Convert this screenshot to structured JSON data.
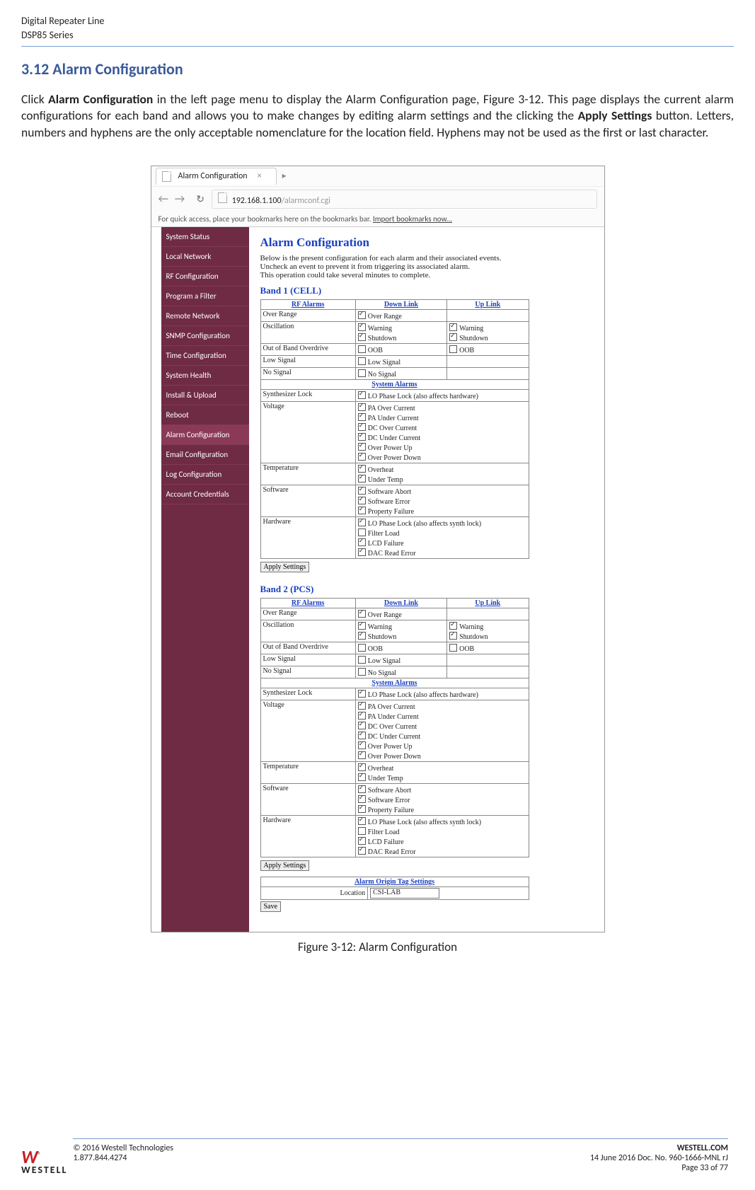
{
  "doc_header": {
    "line1": "Digital Repeater Line",
    "line2": "DSP85 Series"
  },
  "section": {
    "number_title": "3.12  Alarm Configuration"
  },
  "body": {
    "p1_pre": "Click ",
    "p1_b1": "Alarm Configuration",
    "p1_mid": " in the left page menu to display the Alarm Configuration page, Figure 3-12.  This page displays the current alarm configurations for each band and allows you to make changes by editing alarm settings and the clicking the ",
    "p1_b2": "Apply Settings",
    "p1_post": " button. Letters, numbers and hyphens are the only acceptable nomenclature for the location field.  Hyphens may not be used as the first or last character."
  },
  "figure_caption": "Figure 3-12: Alarm Configuration",
  "browser": {
    "tab_title": "Alarm Configuration",
    "tab_x": "×",
    "newtab": "",
    "addr_dark": "192.168.1.100",
    "addr_light": "/alarmconf.cgi",
    "bm_text": "For quick access, place your bookmarks here on the bookmarks bar.  ",
    "bm_link": "Import bookmarks now..."
  },
  "sidebar": {
    "items": [
      "System Status",
      "Local Network",
      "RF Configuration",
      "Program a Filter",
      "Remote Network",
      "SNMP Configuration",
      "Time Configuration",
      "System Health",
      "Install & Upload",
      "Reboot",
      "Alarm Configuration",
      "Email Configuration",
      "Log Configuration",
      "Account Credentials"
    ],
    "active_index": 10
  },
  "content": {
    "title": "Alarm Configuration",
    "intro_1": "Below is the present configuration for each alarm and their associated events.",
    "intro_2": "Uncheck an event to prevent it from triggering its associated alarm.",
    "intro_3": "This operation could take several minutes to complete.",
    "band1_title": "Band 1 (CELL)",
    "band2_title": "Band 2 (PCS)",
    "col_rf": "RF Alarms",
    "col_dl": "Down Link",
    "col_ul": "Up Link",
    "sys_alarms_label": "System Alarms",
    "rows_rf": [
      {
        "name": "Over Range",
        "dl": [
          [
            "Over Range",
            true
          ]
        ],
        "ul": []
      },
      {
        "name": "Oscillation",
        "dl": [
          [
            "Warning",
            true
          ],
          [
            "Shutdown",
            true
          ]
        ],
        "ul": [
          [
            "Warning",
            true
          ],
          [
            "Shutdown",
            true
          ]
        ]
      },
      {
        "name": "Out of Band Overdrive",
        "dl": [
          [
            "OOB",
            false
          ]
        ],
        "ul": [
          [
            "OOB",
            false
          ]
        ]
      },
      {
        "name": "Low Signal",
        "dl": [
          [
            "Low Signal",
            false
          ]
        ],
        "ul": []
      },
      {
        "name": "No Signal",
        "dl": [
          [
            "No Signal",
            false
          ]
        ],
        "ul": []
      }
    ],
    "rows_sys": [
      {
        "name": "Synthesizer Lock",
        "items": [
          [
            "LO Phase Lock (also affects hardware)",
            true
          ]
        ]
      },
      {
        "name": "Voltage",
        "items": [
          [
            "PA Over Current",
            true
          ],
          [
            "PA Under Current",
            true
          ],
          [
            "DC Over Current",
            true
          ],
          [
            "DC Under Current",
            true
          ],
          [
            "Over Power Up",
            true
          ],
          [
            "Over Power Down",
            true
          ]
        ]
      },
      {
        "name": "Temperature",
        "items": [
          [
            "Overheat",
            true
          ],
          [
            "Under Temp",
            true
          ]
        ]
      },
      {
        "name": "Software",
        "items": [
          [
            "Software Abort",
            true
          ],
          [
            "Software Error",
            true
          ],
          [
            "Property Failure",
            true
          ]
        ]
      },
      {
        "name": "Hardware",
        "items": [
          [
            "LO Phase Lock (also affects synth lock)",
            true
          ],
          [
            "Filter Load",
            false
          ],
          [
            "LCD Failure",
            true
          ],
          [
            "DAC Read Error",
            true
          ]
        ]
      }
    ],
    "apply_label": "Apply Settings",
    "origin_title": "Alarm Origin Tag Settings",
    "origin_field": "Location",
    "origin_value": "CSI-LAB",
    "save_label": "Save"
  },
  "footer": {
    "logo_text": "WESTELL",
    "site": "WESTELL.COM",
    "left1": "© 2016 Westell Technologies",
    "left2": "1.877.844.4274",
    "right1": "14 June 2016 Doc. No. 960-1666-MNL rJ",
    "right2": "Page 33 of 77"
  }
}
